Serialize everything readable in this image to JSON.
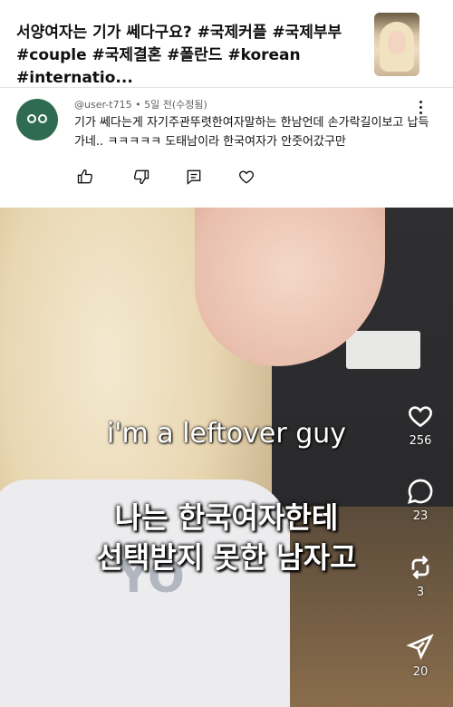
{
  "video": {
    "title": "서양여자는 기가 쎄다구요? #국제커플 #국제부부\n#couple #국제결혼 #폴란드 #korean #internatio..."
  },
  "comment": {
    "author": "@user-t715",
    "time": "5일 전(수정됨)",
    "text": "기가 쎄다는게 자기주관뚜렷한여자말하는 한남언데 손가락길이보고 납득가네.. ㅋㅋㅋㅋㅋ 도태남이라 한국여자가 안줏어갔구만",
    "icons": [
      "like-icon",
      "dislike-icon",
      "reply-icon",
      "heart-icon",
      "more-vertical-icon"
    ]
  },
  "player": {
    "caption_en": "i'm a leftover guy",
    "caption_ko": "나는 한국여자한테\n선택받지 못한 남자고",
    "shirt_print": "YO"
  },
  "side_actions": [
    {
      "icon": "heart-icon",
      "count": "256"
    },
    {
      "icon": "comment-icon",
      "count": "23"
    },
    {
      "icon": "remix-icon",
      "count": "3"
    },
    {
      "icon": "share-icon",
      "count": "20"
    }
  ]
}
